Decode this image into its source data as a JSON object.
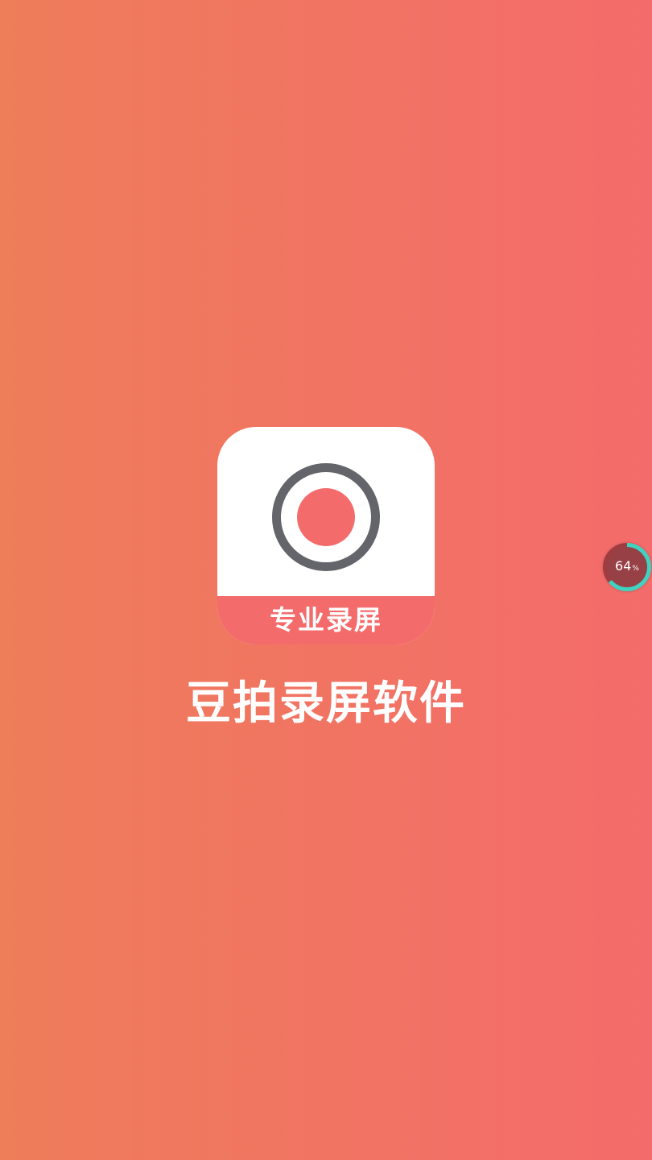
{
  "screen": {
    "type": "splash",
    "background_start": "#ee7d5a",
    "background_end": "#f46b6b"
  },
  "app_icon": {
    "banner_label": "专业录屏",
    "ring_color": "#63656a",
    "dot_color": "#f46b6b",
    "banner_color": "#f46b6b",
    "icon_name": "record-camera-icon"
  },
  "app_name": "豆拍录屏软件",
  "floating_widget": {
    "value": "64",
    "unit": "%",
    "progress_fraction": 0.64,
    "ring_color": "#3ed3c0"
  }
}
